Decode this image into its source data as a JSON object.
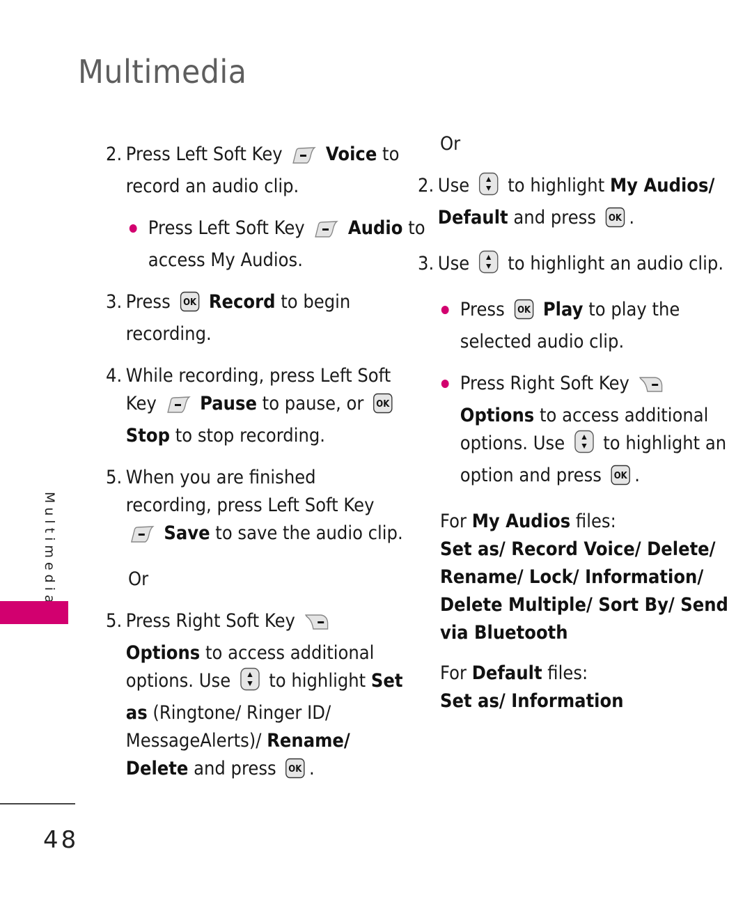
{
  "header": {
    "title": "Multimedia"
  },
  "sidebar": {
    "section_label": "Multimedia",
    "tab_color": "#d2006f"
  },
  "footer": {
    "page_number": "48"
  },
  "accent_color": "#d2006f",
  "left_column": {
    "step2": {
      "num": "2.",
      "t1": "Press Left Soft Key",
      "b1": "Voice",
      "t2": "to record an audio clip."
    },
    "step2_bullet": {
      "t1": "Press Left Soft Key",
      "b1": "Audio",
      "t2": "to access My Audios."
    },
    "step3": {
      "num": "3.",
      "t1": "Press",
      "b1": "Record",
      "t2": "to begin recording."
    },
    "step4": {
      "num": "4.",
      "t1": "While recording, press Left Soft Key",
      "b1": "Pause",
      "t2": "to pause, or",
      "b2": "Stop",
      "t3": "to stop recording."
    },
    "step5a": {
      "num": "5.",
      "t1": "When you are finished recording, press Left Soft Key",
      "b1": "Save",
      "t2": "to save the audio clip."
    },
    "or": "Or",
    "step5b": {
      "num": "5.",
      "t1": "Press Right Soft Key",
      "b1": "Options",
      "t2": "to access additional options. Use",
      "t3": "to highlight",
      "b2": "Set as",
      "t4": "(Ringtone/ Ringer ID/ MessageAlerts)/",
      "b3": "Rename/",
      "b4": "Delete",
      "t5": "and press",
      "t6": "."
    }
  },
  "right_column": {
    "or": "Or",
    "step2": {
      "num": "2.",
      "t1": "Use",
      "t2": "to highlight",
      "b1": "My Audios/ Default",
      "t3": "and press",
      "t4": "."
    },
    "step3": {
      "num": "3.",
      "t1": "Use",
      "t2": "to highlight an audio clip."
    },
    "bullet1": {
      "t1": "Press",
      "b1": "Play",
      "t2": "to play the selected audio clip."
    },
    "bullet2": {
      "t1": "Press Right Soft Key",
      "b1": "Options",
      "t2": "to access additional options. Use",
      "t3": "to highlight an option and press",
      "t4": "."
    },
    "my_audios": {
      "label_pre": "For",
      "label_bold": "My Audios",
      "label_post": "files:",
      "options": "Set as/ Record Voice/ Delete/ Rename/ Lock/ Information/ Delete Multiple/ Sort By/ Send via Bluetooth"
    },
    "default_files": {
      "label_pre": "For",
      "label_bold": "Default",
      "label_post": "files:",
      "options": "Set as/ Information"
    }
  },
  "icons": {
    "left_soft_key": "left-soft-key-icon",
    "right_soft_key": "right-soft-key-icon",
    "ok_key": "ok-key-icon",
    "nav_key": "nav-up-down-icon"
  }
}
